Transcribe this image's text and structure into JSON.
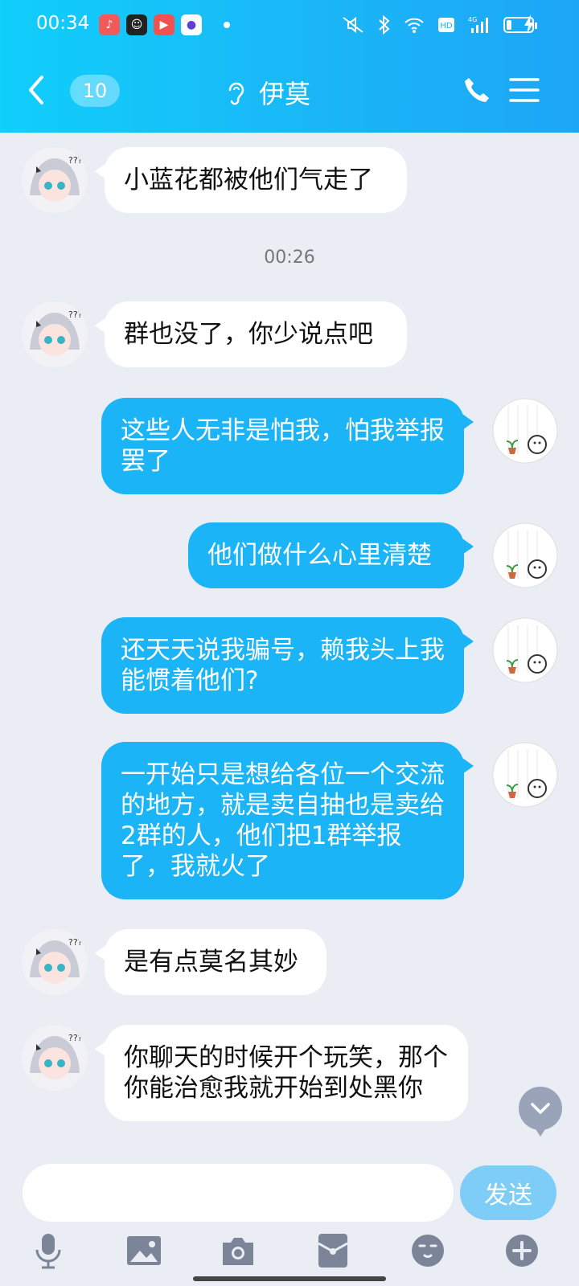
{
  "status_bar": {
    "time": "00:34",
    "battery": "low",
    "network": "4G"
  },
  "header": {
    "back_label": "",
    "unread_count": "10",
    "title": "伊莫",
    "colors": {
      "header_start": "#10cffb",
      "header_end": "#1da6f6"
    }
  },
  "messages": [
    {
      "side": "in",
      "text": "小蓝花都被他们气走了"
    },
    {
      "timestamp": "00:26"
    },
    {
      "side": "in",
      "text": "群也没了，你少说点吧"
    },
    {
      "side": "out",
      "text": "这些人无非是怕我，怕我举报罢了"
    },
    {
      "side": "out",
      "text": "他们做什么心里清楚"
    },
    {
      "side": "out",
      "text": "还天天说我骗号，赖我头上我能惯着他们?"
    },
    {
      "side": "out",
      "text": "一开始只是想给各位一个交流的地方，就是卖自抽也是卖给2群的人，他们把1群举报了，我就火了"
    },
    {
      "side": "in",
      "text": "是有点莫名其妙"
    },
    {
      "side": "in",
      "text": "你聊天的时候开个玩笑，那个你能治愈我就开始到处黑你"
    }
  ],
  "input": {
    "value": "",
    "placeholder": "",
    "send_label": "发送"
  },
  "toolbar_icons": [
    "microphone-icon",
    "image-icon",
    "camera-icon",
    "red-packet-icon",
    "emoji-icon",
    "plus-icon"
  ]
}
